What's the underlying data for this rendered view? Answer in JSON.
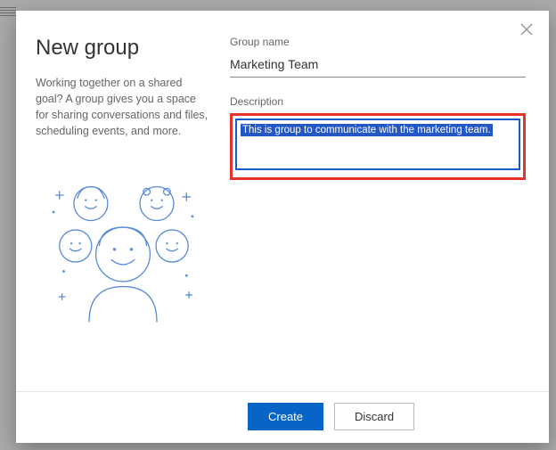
{
  "dialog": {
    "title": "New group",
    "subtitle": "Working together on a shared goal? A group gives you a space for sharing conversations and files, scheduling events, and more."
  },
  "fields": {
    "group_name_label": "Group name",
    "group_name_value": "Marketing Team",
    "description_label": "Description",
    "description_value": "This is group to communicate with the marketing team."
  },
  "buttons": {
    "create": "Create",
    "discard": "Discard"
  }
}
